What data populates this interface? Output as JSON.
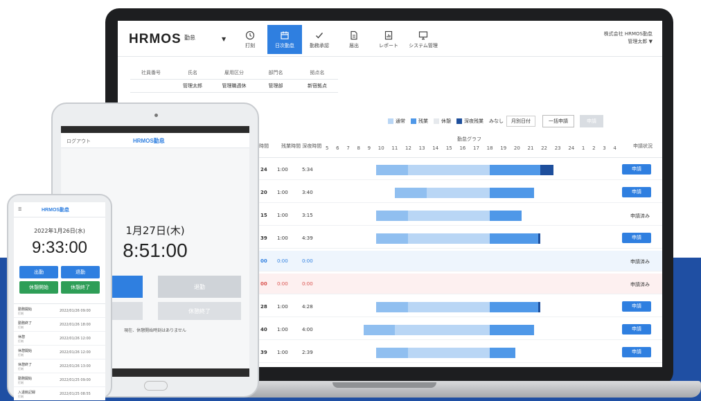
{
  "colors": {
    "primary": "#2f7fe0",
    "bar_light": "#b9d6f5",
    "bar_mid": "#90bff0",
    "bar_main": "#4f98e8",
    "bar_dark": "#1e4f9c",
    "green": "#2e9e57",
    "band": "#1f4fa3"
  },
  "laptop": {
    "logo": "HRMOS",
    "logo_sub": "勤怠",
    "nav": [
      {
        "label": "打刻",
        "icon": "clock-icon"
      },
      {
        "label": "日次勤怠",
        "icon": "calendar-icon",
        "active": true
      },
      {
        "label": "勤務承認",
        "icon": "check-icon"
      },
      {
        "label": "届出",
        "icon": "document-icon"
      },
      {
        "label": "レポート",
        "icon": "report-icon"
      },
      {
        "label": "システム管理",
        "icon": "monitor-icon"
      }
    ],
    "user": {
      "company": "株式会社 HRMOS勤怠",
      "name": "管理太郎 ▼"
    },
    "info_table": {
      "headers": [
        "社員番号",
        "氏名",
        "雇用区分",
        "部門名",
        "拠点名"
      ],
      "values": [
        "",
        "管理太郎",
        "管理職週休",
        "管理部",
        "新宿拠点"
      ]
    },
    "legend": [
      {
        "label": "通常",
        "color": "#b9d6f5"
      },
      {
        "label": "残業",
        "color": "#4f98e8"
      },
      {
        "label": "休憩",
        "color": "#e6e9ed"
      },
      {
        "label": "深夜残業",
        "color": "#1e4f9c"
      }
    ],
    "legend_select_label": "みなし",
    "legend_select_value": "月別日付",
    "button_outline": "一括申請",
    "button_disabled": "申請",
    "timesheet": {
      "graph_title": "勤怠グラフ",
      "col_a": "時間",
      "col_b": "残業時間 深夜時間",
      "col_action": "申請状況",
      "hours": [
        "5",
        "6",
        "7",
        "8",
        "9",
        "10",
        "11",
        "12",
        "13",
        "14",
        "15",
        "16",
        "17",
        "18",
        "19",
        "20",
        "21",
        "22",
        "23",
        "24",
        "1",
        "2",
        "3",
        "4"
      ],
      "rows": [
        {
          "c1": "24",
          "c2": "1:00",
          "c3": "5:34",
          "action": "申請",
          "action_type": "button",
          "state": "normal",
          "start": 9.0,
          "end": 23.0,
          "dark_from": 22.0
        },
        {
          "c1": "20",
          "c2": "1:00",
          "c3": "3:40",
          "action": "申請",
          "action_type": "button",
          "state": "normal",
          "start": 10.5,
          "end": 21.5,
          "dark_from": null
        },
        {
          "c1": "15",
          "c2": "1:00",
          "c3": "3:15",
          "action": "申請済み",
          "action_type": "text",
          "state": "normal",
          "start": 9.0,
          "end": 20.5,
          "dark_from": null
        },
        {
          "c1": "39",
          "c2": "1:00",
          "c3": "4:39",
          "action": "申請",
          "action_type": "button",
          "state": "normal",
          "start": 9.0,
          "end": 22.0,
          "dark_from": 21.8
        },
        {
          "c1": "00",
          "c2": "0:00",
          "c3": "0:00",
          "action": "申請済み",
          "action_type": "text",
          "state": "blue"
        },
        {
          "c1": "00",
          "c2": "0:00",
          "c3": "0:00",
          "action": "申請済み",
          "action_type": "text",
          "state": "red"
        },
        {
          "c1": "28",
          "c2": "1:00",
          "c3": "4:28",
          "action": "申請",
          "action_type": "button",
          "state": "normal",
          "start": 9.0,
          "end": 22.0,
          "dark_from": 21.8
        },
        {
          "c1": "40",
          "c2": "1:00",
          "c3": "4:00",
          "action": "申請",
          "action_type": "button",
          "state": "normal",
          "start": 8.0,
          "end": 21.5,
          "dark_from": null
        },
        {
          "c1": "39",
          "c2": "1:00",
          "c3": "2:39",
          "action": "申請",
          "action_type": "button",
          "state": "normal",
          "start": 9.0,
          "end": 20.0,
          "dark_from": null
        }
      ]
    }
  },
  "tablet": {
    "back": "ログアウト",
    "logo": "HRMOS勤怠",
    "date": "1月27日(木)",
    "time": "8:51:00",
    "buttons": [
      "出勤",
      "退勤",
      "休憩開始",
      "休憩終了"
    ],
    "note": "現在、休憩開始時刻はありません"
  },
  "phone": {
    "logo": "HRMOS勤怠",
    "date": "2022年1月26日(水)",
    "time": "9:33:00",
    "buttons": [
      "出勤",
      "退勤",
      "休憩開始",
      "休憩終了"
    ],
    "list": [
      {
        "label": "勤務開始",
        "sub": "打刻",
        "time": "2022/01/26 09:00"
      },
      {
        "label": "勤務終了",
        "sub": "打刻",
        "time": "2022/01/26 18:00"
      },
      {
        "label": "休憩",
        "sub": "打刻",
        "time": "2022/01/26 12:00"
      },
      {
        "label": "休憩開始",
        "sub": "打刻",
        "time": "2022/01/26 12:00"
      },
      {
        "label": "休憩終了",
        "sub": "打刻",
        "time": "2022/01/26 13:00"
      },
      {
        "label": "勤務開始",
        "sub": "打刻",
        "time": "2022/01/25 09:00"
      },
      {
        "label": "入退館記録",
        "sub": "打刻",
        "time": "2022/01/25 08:55"
      },
      {
        "label": "出勤",
        "sub": "打刻",
        "time": "2022/01/25 09:00"
      }
    ]
  }
}
